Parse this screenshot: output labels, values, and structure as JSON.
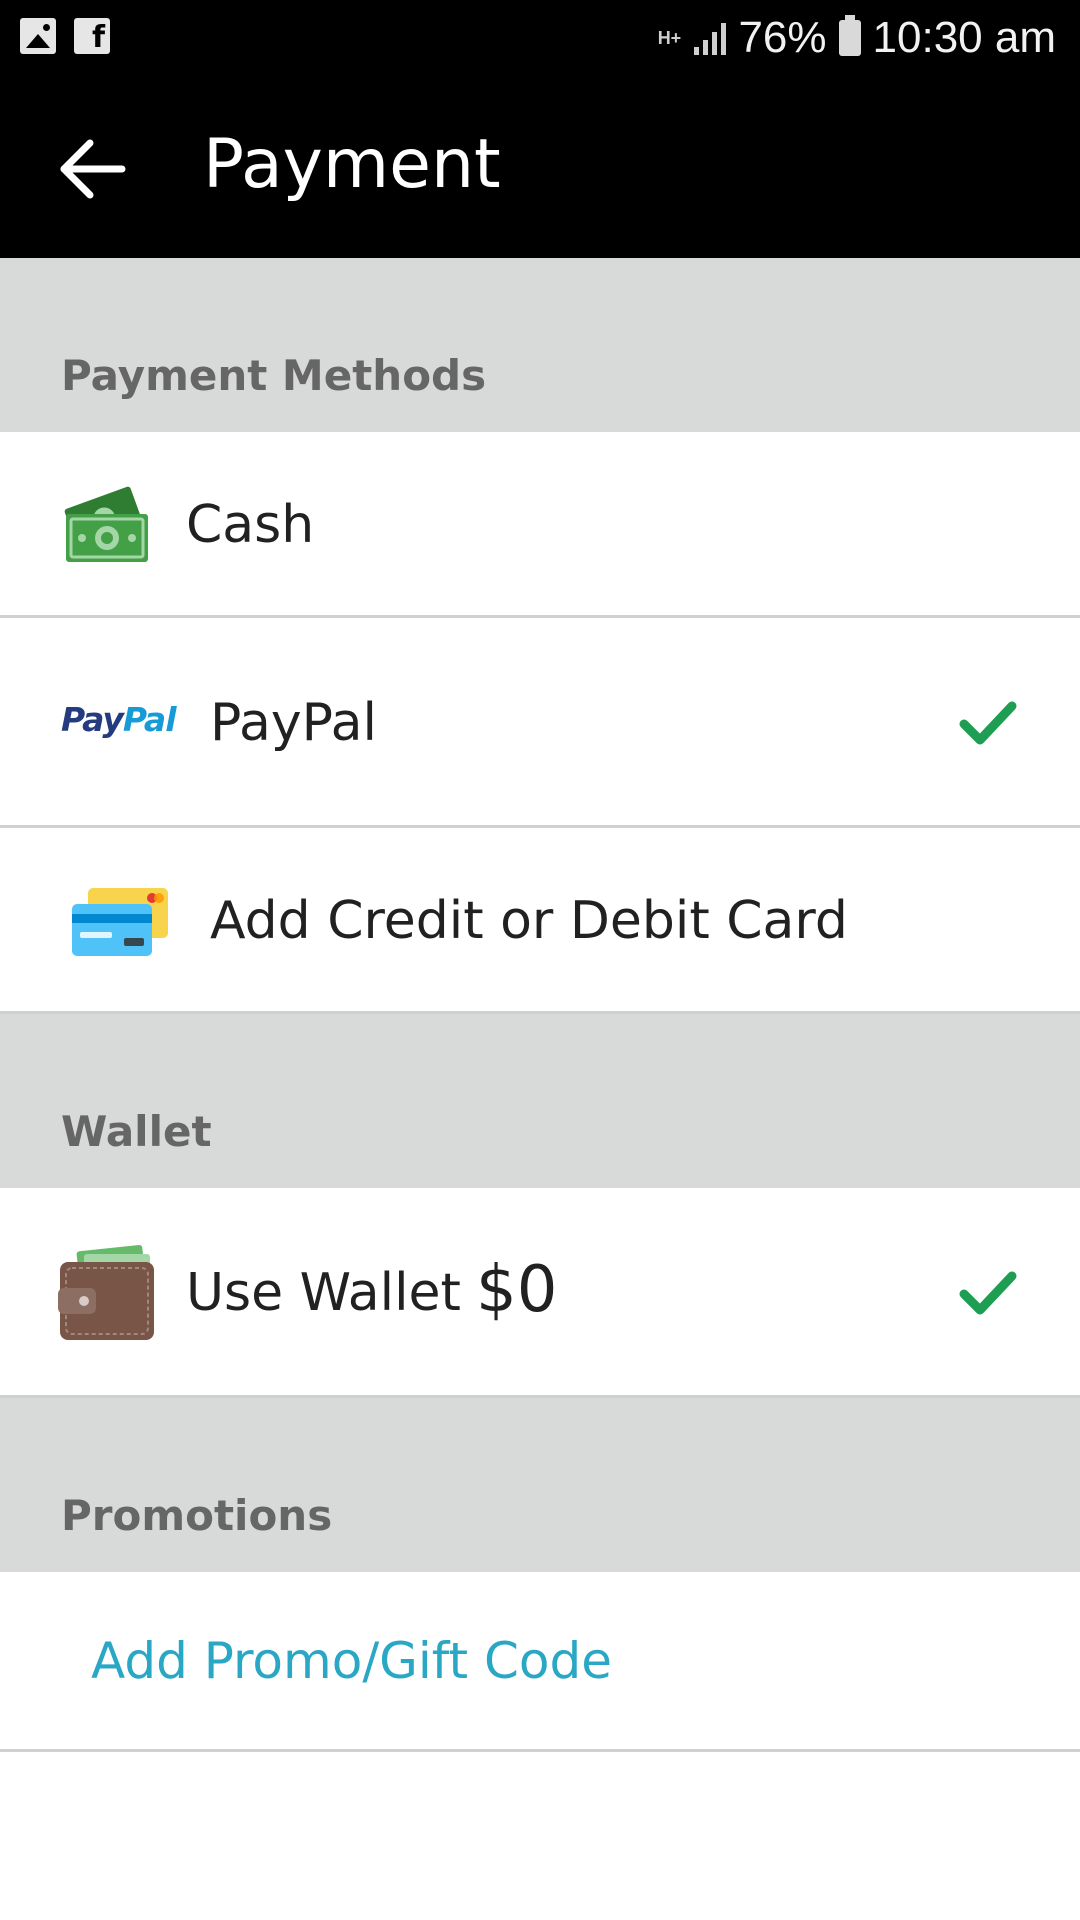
{
  "status_bar": {
    "network": "H+",
    "battery": "76%",
    "time": "10:30 am"
  },
  "app_bar": {
    "title": "Payment"
  },
  "payment_methods": {
    "header": "Payment Methods",
    "items": [
      {
        "label": "Cash",
        "icon": "cash-icon",
        "selected": false
      },
      {
        "label": "PayPal",
        "icon": "paypal-logo",
        "logo_text": "PayPal",
        "selected": true
      },
      {
        "label": "Add Credit or Debit Card",
        "icon": "credit-card-icon",
        "selected": false
      }
    ]
  },
  "wallet": {
    "header": "Wallet",
    "label": "Use Wallet",
    "amount": "$0",
    "icon": "wallet-icon",
    "selected": true
  },
  "promotions": {
    "header": "Promotions",
    "link": "Add Promo/Gift Code"
  },
  "colors": {
    "app_bar": "#000000",
    "section_header_bg": "#d8d9d9",
    "section_header_text": "#666666",
    "check": "#1e9e52",
    "promo_link": "#2aa7c4",
    "paypal_dark": "#253b80",
    "paypal_light": "#179bd7"
  }
}
